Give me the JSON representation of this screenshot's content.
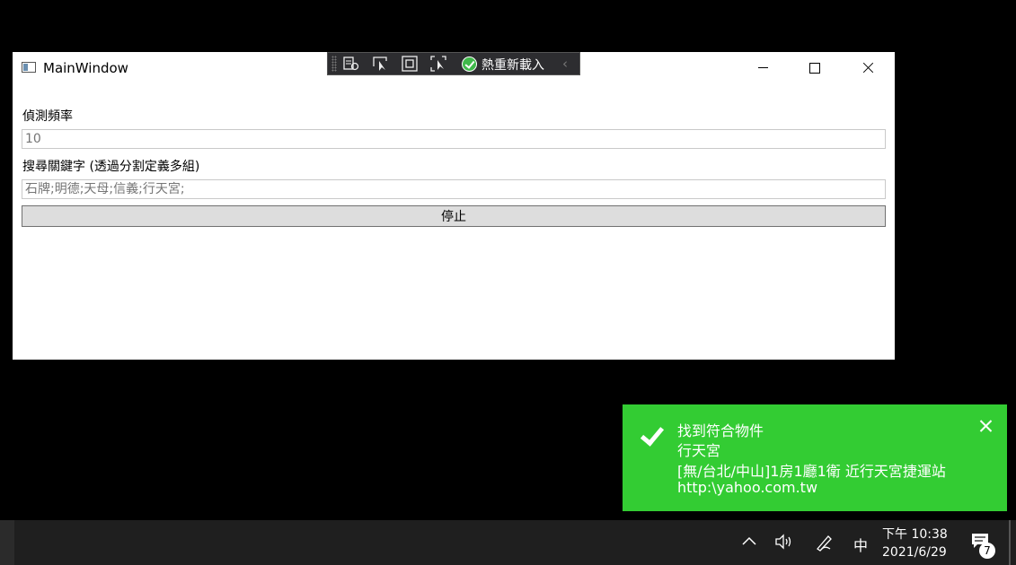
{
  "window": {
    "title": "MainWindow"
  },
  "debug_toolbar": {
    "hot_reload_label": "熱重新載入"
  },
  "form": {
    "frequency_label": "偵測頻率",
    "frequency_placeholder": "10",
    "keywords_label": "搜尋關鍵字 (透過分割定義多組)",
    "keywords_placeholder": "石牌;明德;天母;信義;行天宮;",
    "stop_button_label": "停止"
  },
  "toast": {
    "title": "找到符合物件",
    "line1": "行天宮",
    "line2": "[無/台北/中山]1房1廳1衛 近行天宮捷運站",
    "line3": "http:\\yahoo.com.tw",
    "color": "#33cc33"
  },
  "taskbar": {
    "ime_label": "中",
    "time": "下午 10:38",
    "date": "2021/6/29",
    "notification_count": "7"
  }
}
